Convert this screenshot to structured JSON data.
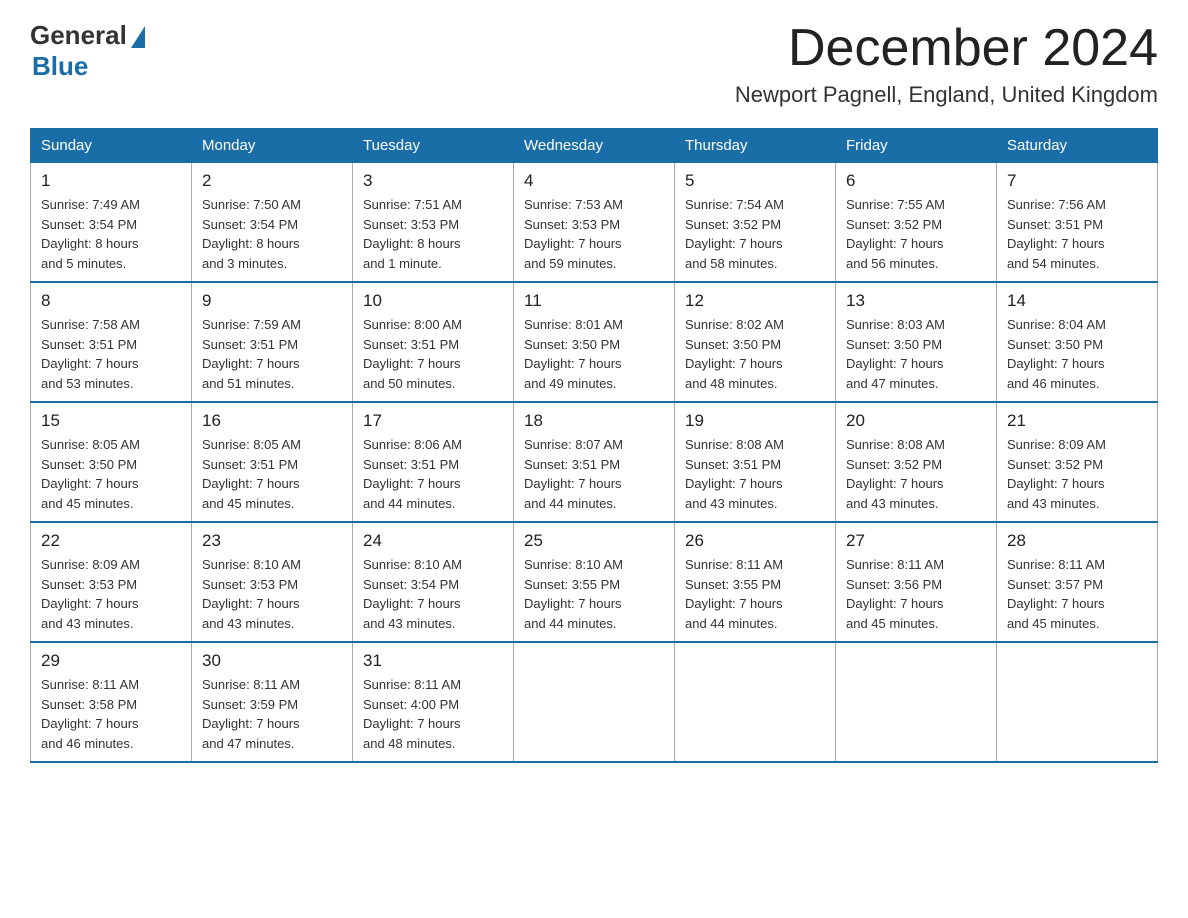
{
  "header": {
    "logo_general": "General",
    "logo_blue": "Blue",
    "month_year": "December 2024",
    "location": "Newport Pagnell, England, United Kingdom"
  },
  "days_of_week": [
    "Sunday",
    "Monday",
    "Tuesday",
    "Wednesday",
    "Thursday",
    "Friday",
    "Saturday"
  ],
  "weeks": [
    [
      {
        "day": "1",
        "sunrise": "7:49 AM",
        "sunset": "3:54 PM",
        "daylight": "8 hours and 5 minutes."
      },
      {
        "day": "2",
        "sunrise": "7:50 AM",
        "sunset": "3:54 PM",
        "daylight": "8 hours and 3 minutes."
      },
      {
        "day": "3",
        "sunrise": "7:51 AM",
        "sunset": "3:53 PM",
        "daylight": "8 hours and 1 minute."
      },
      {
        "day": "4",
        "sunrise": "7:53 AM",
        "sunset": "3:53 PM",
        "daylight": "7 hours and 59 minutes."
      },
      {
        "day": "5",
        "sunrise": "7:54 AM",
        "sunset": "3:52 PM",
        "daylight": "7 hours and 58 minutes."
      },
      {
        "day": "6",
        "sunrise": "7:55 AM",
        "sunset": "3:52 PM",
        "daylight": "7 hours and 56 minutes."
      },
      {
        "day": "7",
        "sunrise": "7:56 AM",
        "sunset": "3:51 PM",
        "daylight": "7 hours and 54 minutes."
      }
    ],
    [
      {
        "day": "8",
        "sunrise": "7:58 AM",
        "sunset": "3:51 PM",
        "daylight": "7 hours and 53 minutes."
      },
      {
        "day": "9",
        "sunrise": "7:59 AM",
        "sunset": "3:51 PM",
        "daylight": "7 hours and 51 minutes."
      },
      {
        "day": "10",
        "sunrise": "8:00 AM",
        "sunset": "3:51 PM",
        "daylight": "7 hours and 50 minutes."
      },
      {
        "day": "11",
        "sunrise": "8:01 AM",
        "sunset": "3:50 PM",
        "daylight": "7 hours and 49 minutes."
      },
      {
        "day": "12",
        "sunrise": "8:02 AM",
        "sunset": "3:50 PM",
        "daylight": "7 hours and 48 minutes."
      },
      {
        "day": "13",
        "sunrise": "8:03 AM",
        "sunset": "3:50 PM",
        "daylight": "7 hours and 47 minutes."
      },
      {
        "day": "14",
        "sunrise": "8:04 AM",
        "sunset": "3:50 PM",
        "daylight": "7 hours and 46 minutes."
      }
    ],
    [
      {
        "day": "15",
        "sunrise": "8:05 AM",
        "sunset": "3:50 PM",
        "daylight": "7 hours and 45 minutes."
      },
      {
        "day": "16",
        "sunrise": "8:05 AM",
        "sunset": "3:51 PM",
        "daylight": "7 hours and 45 minutes."
      },
      {
        "day": "17",
        "sunrise": "8:06 AM",
        "sunset": "3:51 PM",
        "daylight": "7 hours and 44 minutes."
      },
      {
        "day": "18",
        "sunrise": "8:07 AM",
        "sunset": "3:51 PM",
        "daylight": "7 hours and 44 minutes."
      },
      {
        "day": "19",
        "sunrise": "8:08 AM",
        "sunset": "3:51 PM",
        "daylight": "7 hours and 43 minutes."
      },
      {
        "day": "20",
        "sunrise": "8:08 AM",
        "sunset": "3:52 PM",
        "daylight": "7 hours and 43 minutes."
      },
      {
        "day": "21",
        "sunrise": "8:09 AM",
        "sunset": "3:52 PM",
        "daylight": "7 hours and 43 minutes."
      }
    ],
    [
      {
        "day": "22",
        "sunrise": "8:09 AM",
        "sunset": "3:53 PM",
        "daylight": "7 hours and 43 minutes."
      },
      {
        "day": "23",
        "sunrise": "8:10 AM",
        "sunset": "3:53 PM",
        "daylight": "7 hours and 43 minutes."
      },
      {
        "day": "24",
        "sunrise": "8:10 AM",
        "sunset": "3:54 PM",
        "daylight": "7 hours and 43 minutes."
      },
      {
        "day": "25",
        "sunrise": "8:10 AM",
        "sunset": "3:55 PM",
        "daylight": "7 hours and 44 minutes."
      },
      {
        "day": "26",
        "sunrise": "8:11 AM",
        "sunset": "3:55 PM",
        "daylight": "7 hours and 44 minutes."
      },
      {
        "day": "27",
        "sunrise": "8:11 AM",
        "sunset": "3:56 PM",
        "daylight": "7 hours and 45 minutes."
      },
      {
        "day": "28",
        "sunrise": "8:11 AM",
        "sunset": "3:57 PM",
        "daylight": "7 hours and 45 minutes."
      }
    ],
    [
      {
        "day": "29",
        "sunrise": "8:11 AM",
        "sunset": "3:58 PM",
        "daylight": "7 hours and 46 minutes."
      },
      {
        "day": "30",
        "sunrise": "8:11 AM",
        "sunset": "3:59 PM",
        "daylight": "7 hours and 47 minutes."
      },
      {
        "day": "31",
        "sunrise": "8:11 AM",
        "sunset": "4:00 PM",
        "daylight": "7 hours and 48 minutes."
      },
      null,
      null,
      null,
      null
    ]
  ]
}
